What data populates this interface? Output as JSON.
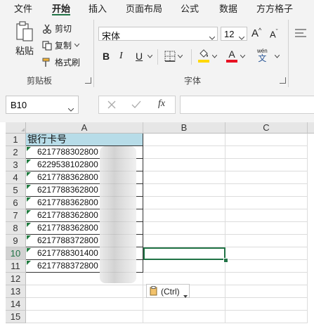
{
  "tabs": [
    "文件",
    "开始",
    "插入",
    "页面布局",
    "公式",
    "数据",
    "方方格子"
  ],
  "active_tab": "开始",
  "clipboard": {
    "paste_label": "粘贴",
    "cut_label": "剪切",
    "copy_label": "复制",
    "format_painter_label": "格式刷",
    "group_label": "剪贴板"
  },
  "font": {
    "name": "宋体",
    "size": "12",
    "bold": "B",
    "italic": "I",
    "underline": "U",
    "wen_label": "wén",
    "wen_char": "文",
    "group_label": "字体",
    "font_color": "#e81123",
    "fill_color": "#ffd800"
  },
  "name_box": "B10",
  "formula_value": "",
  "columns": [
    "A",
    "B",
    "C"
  ],
  "rows": [
    "1",
    "2",
    "3",
    "4",
    "5",
    "6",
    "7",
    "8",
    "9",
    "10",
    "11",
    "12",
    "13",
    "14",
    "15"
  ],
  "header_cell": "银行卡号",
  "data_cells": [
    "6217788302800",
    "6229538102800",
    "6217788362800",
    "6217788362800",
    "6217788362800",
    "6217788362800",
    "6217788362800",
    "6217788372800",
    "6217788301400",
    "6217788372800"
  ],
  "paste_options_label": "(Ctrl)",
  "selected_cell": "B10",
  "accent_color": "#217346",
  "header_fill": "#b7dce8"
}
